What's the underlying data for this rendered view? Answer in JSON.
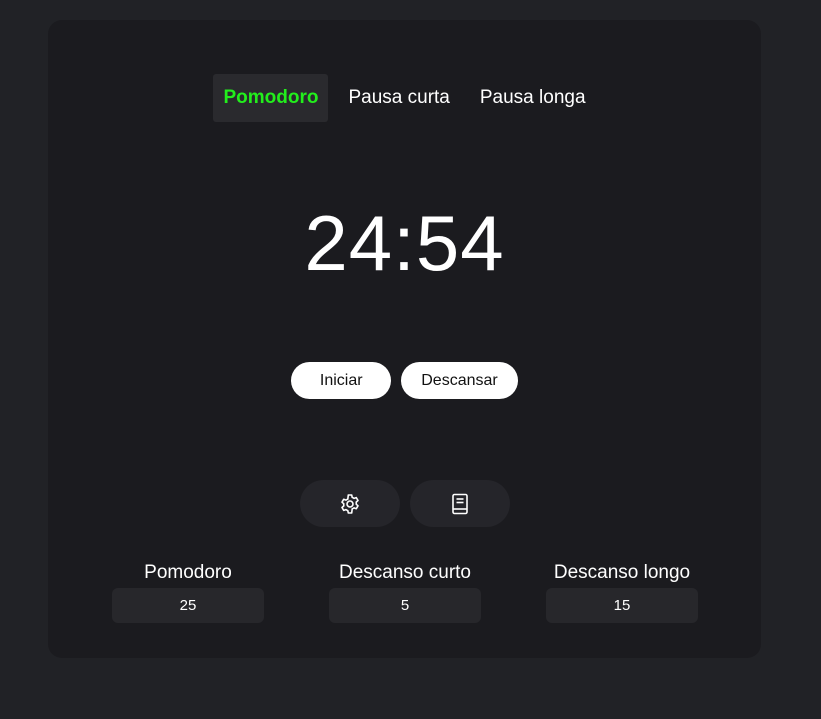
{
  "tabs": [
    {
      "label": "Pomodoro",
      "active": true
    },
    {
      "label": "Pausa curta",
      "active": false
    },
    {
      "label": "Pausa longa",
      "active": false
    }
  ],
  "timer": {
    "display": "24:54"
  },
  "actions": {
    "start_label": "Iniciar",
    "rest_label": "Descansar"
  },
  "icons": {
    "settings": "gear-icon",
    "notes": "document-icon"
  },
  "settings": {
    "pomodoro": {
      "label": "Pomodoro",
      "value": "25"
    },
    "short_break": {
      "label": "Descanso curto",
      "value": "5"
    },
    "long_break": {
      "label": "Descanso longo",
      "value": "15"
    }
  },
  "colors": {
    "page_bg": "#212226",
    "card_bg": "#1b1b1f",
    "active_tab_text": "#22ee1c",
    "active_tab_bg": "#2a2a2e",
    "button_bg": "#ffffff",
    "input_bg": "#27272b"
  }
}
